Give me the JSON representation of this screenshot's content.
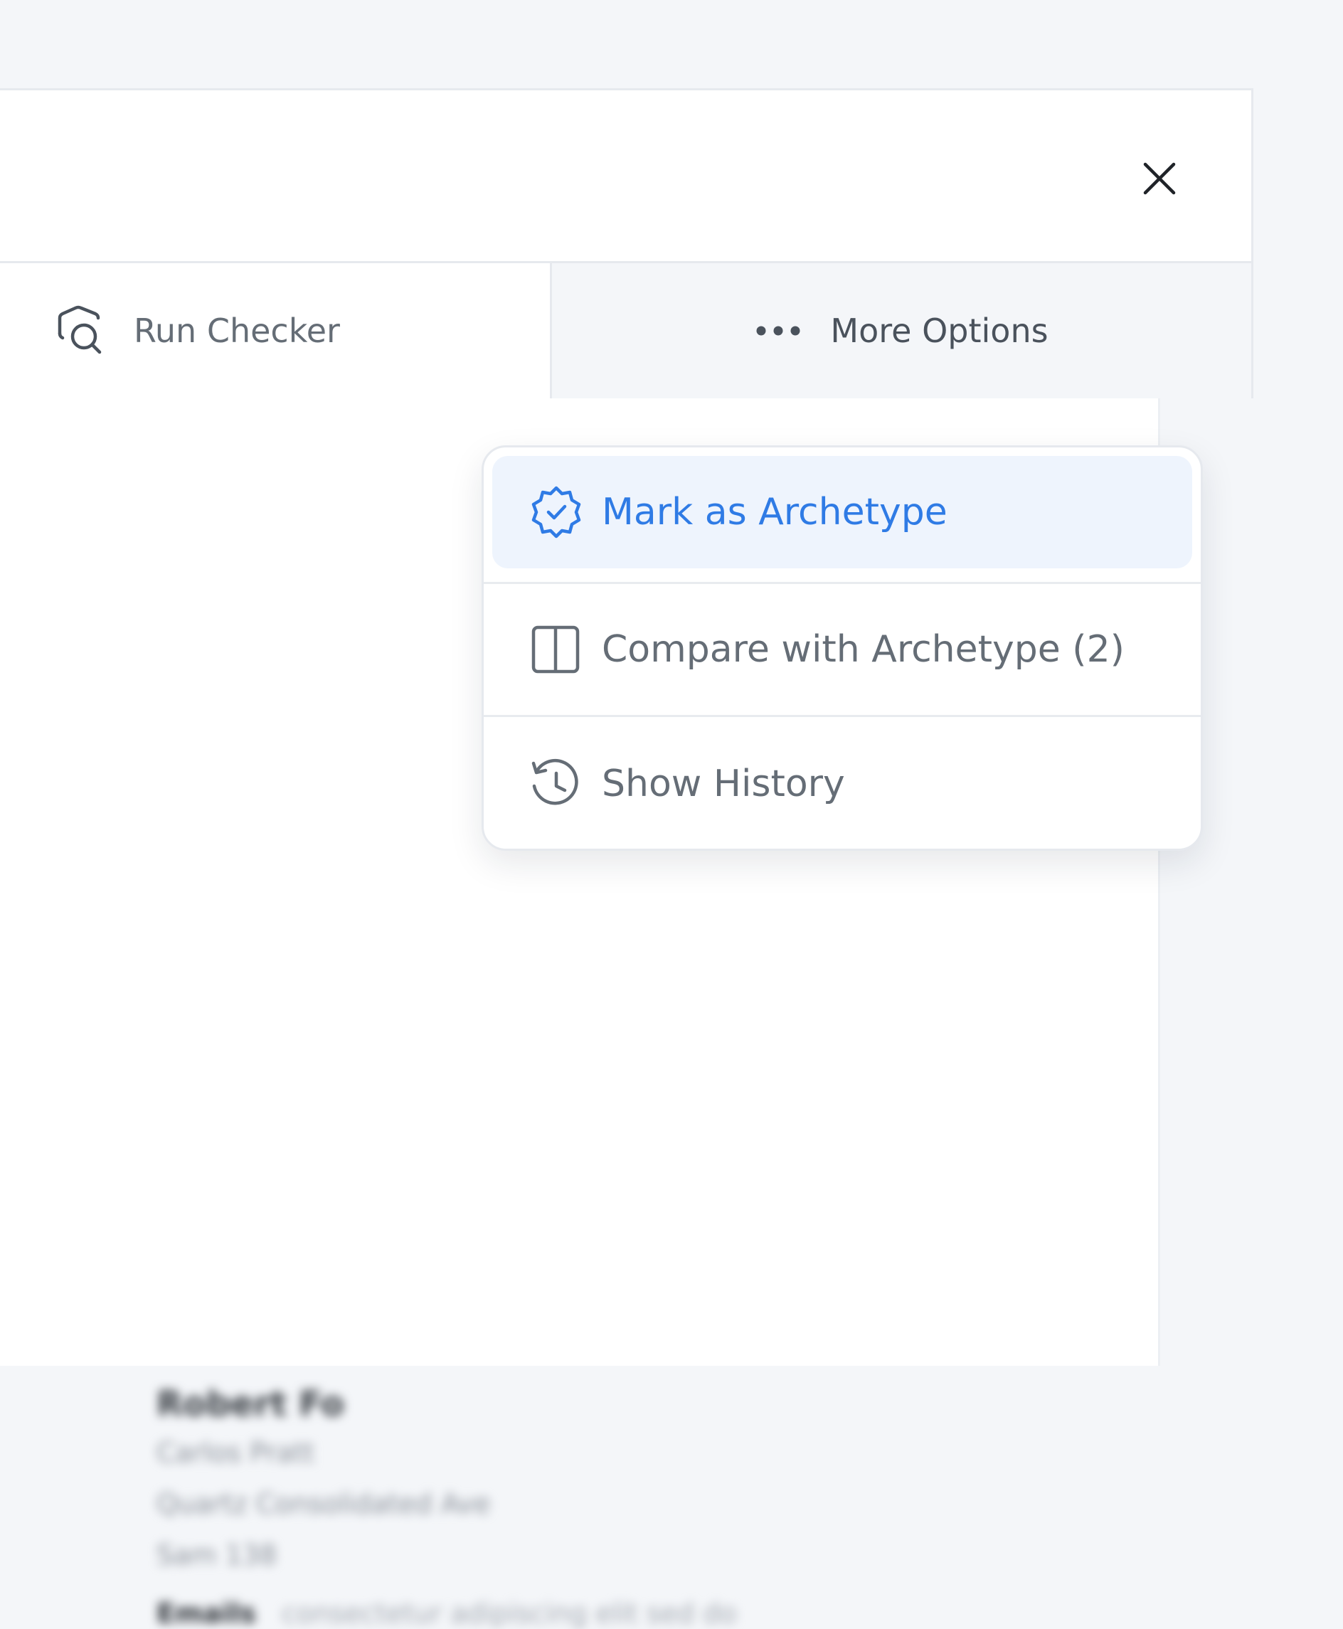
{
  "toolbar": {
    "run_checker_label": "Run Checker",
    "more_options_label": "More Options"
  },
  "dropdown": {
    "items": [
      {
        "label": "Mark as Archetype",
        "icon": "badge-check-icon",
        "active": true,
        "color": "#2f7be5"
      },
      {
        "label": "Compare with Archetype (2)",
        "icon": "columns-icon"
      },
      {
        "label": "Show History",
        "icon": "history-icon"
      }
    ]
  },
  "document": {
    "blurred_lines": [
      "Robert Fo",
      "Carlos Pratt",
      "Quartz Consolidated Ave",
      "Sam 138",
      "Emails",
      "consectetur adipiscing elit sed do"
    ]
  },
  "colors": {
    "accent": "#2f7be5",
    "background": "#f4f6f9",
    "border": "#e6e9ee",
    "muted_text": "#656d76"
  }
}
